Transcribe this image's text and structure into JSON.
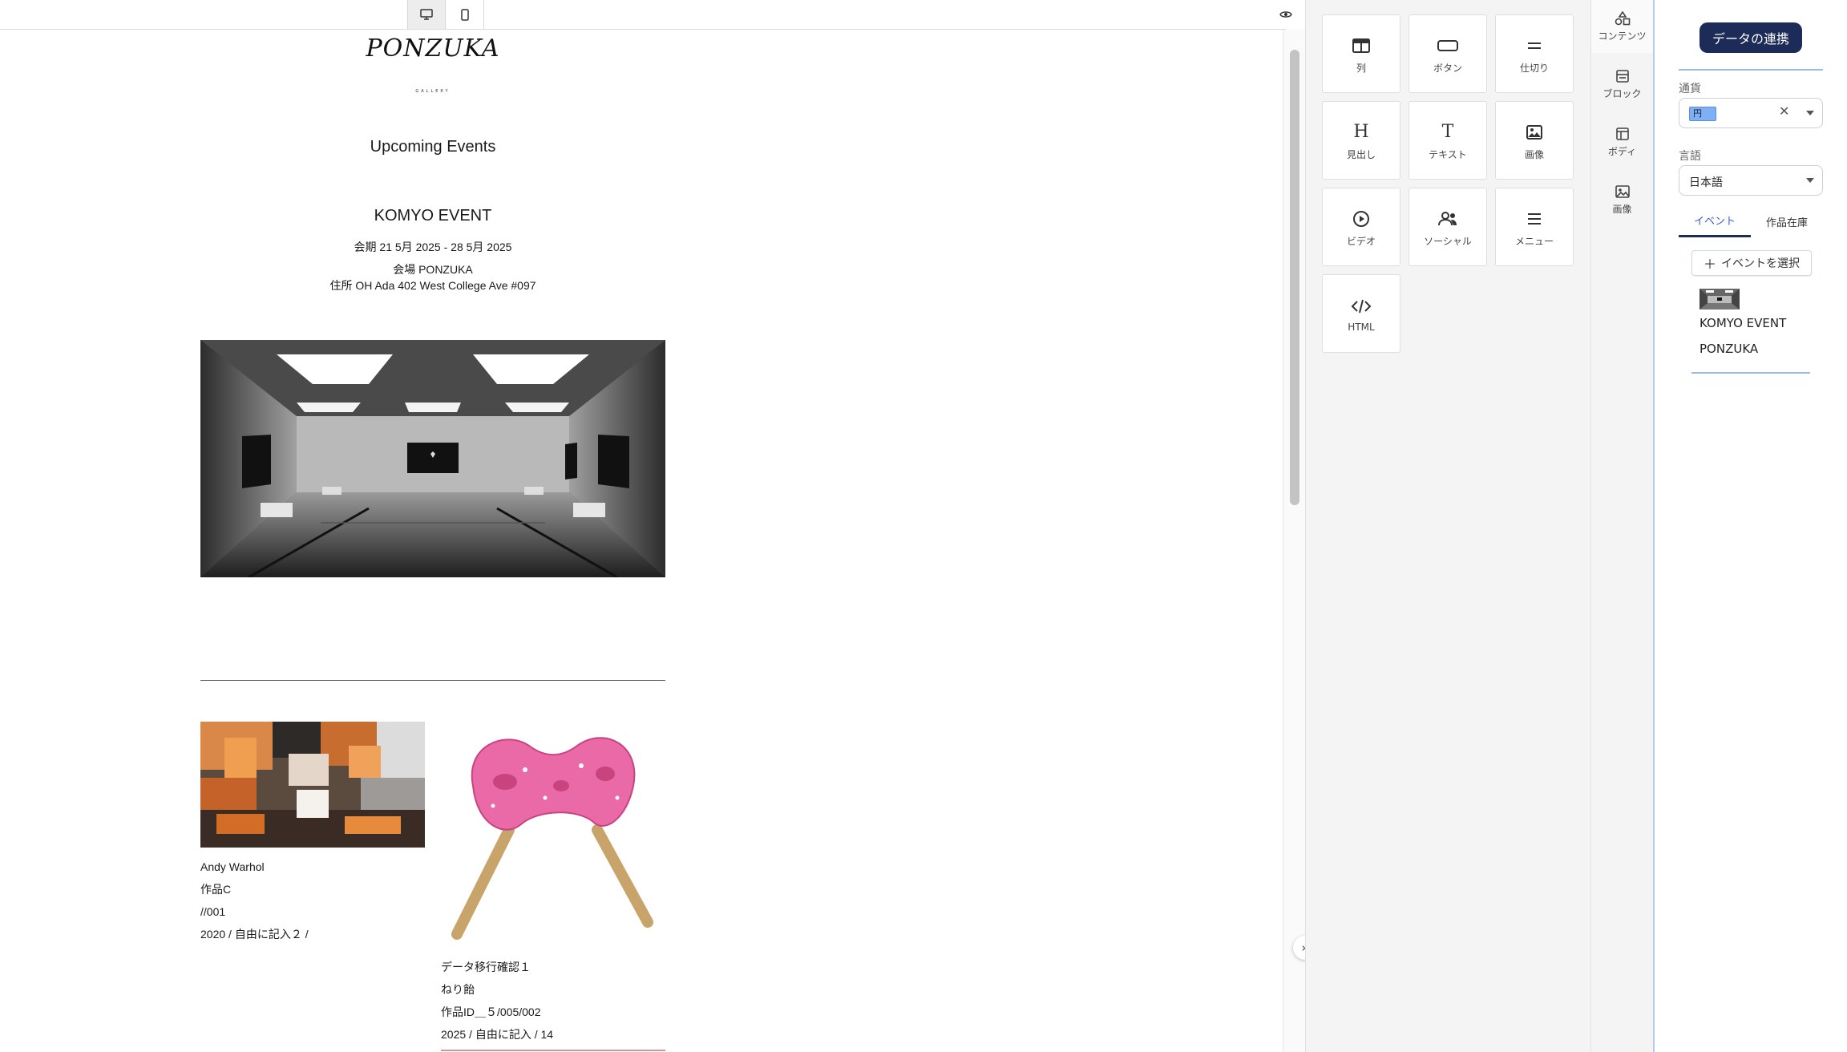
{
  "canvas": {
    "logo_text": "PONZUKA",
    "logo_sub": "GALLERY",
    "section_title": "Upcoming Events",
    "event": {
      "name": "KOMYO EVENT",
      "period": "会期 21 5月 2025 - 28 5月 2025",
      "venue": "会場  PONZUKA",
      "address": "住所  OH Ada 402 West College Ave #097"
    },
    "artworks": [
      {
        "artist": "Andy Warhol",
        "title": "作品C",
        "id": "//001",
        "detail": "2020 / 自由に記入２  /"
      },
      {
        "artist": "データ移行確認１",
        "title": "ねり飴",
        "id": "作品ID＿５/005/002",
        "detail": "2025 / 自由に記入  / 14"
      }
    ]
  },
  "toolbar": {
    "desktop_icon": "desktop-icon",
    "mobile_icon": "mobile-icon",
    "preview_icon": "eye-icon"
  },
  "blocks": [
    {
      "label": "列",
      "icon": "columns-icon"
    },
    {
      "label": "ボタン",
      "icon": "button-icon"
    },
    {
      "label": "仕切り",
      "icon": "divider-icon"
    },
    {
      "label": "見出し",
      "icon": "heading-icon"
    },
    {
      "label": "テキスト",
      "icon": "text-icon"
    },
    {
      "label": "画像",
      "icon": "image-icon"
    },
    {
      "label": "ビデオ",
      "icon": "video-icon"
    },
    {
      "label": "ソーシャル",
      "icon": "social-icon"
    },
    {
      "label": "メニュー",
      "icon": "menu-icon"
    },
    {
      "label": "HTML",
      "icon": "html-icon"
    }
  ],
  "rail": [
    {
      "label": "コンテンツ",
      "icon": "shapes-icon"
    },
    {
      "label": "ブロック",
      "icon": "block-icon"
    },
    {
      "label": "ボディ",
      "icon": "layout-icon"
    },
    {
      "label": "画像",
      "icon": "images-icon"
    }
  ],
  "settings": {
    "sync_button": "データの連携",
    "currency_label": "通貨",
    "currency_value": "円",
    "language_label": "言語",
    "language_value": "日本語",
    "tabs": [
      "イベント",
      "作品在庫"
    ],
    "select_event_button": "イベントを選択",
    "selected_event": {
      "name": "KOMYO EVENT",
      "venue": "PONZUKA"
    }
  },
  "colors": {
    "accent_dark": "#1c2b57",
    "accent_blue": "#3d5cd6",
    "chip_blue": "#7fb0f5"
  }
}
